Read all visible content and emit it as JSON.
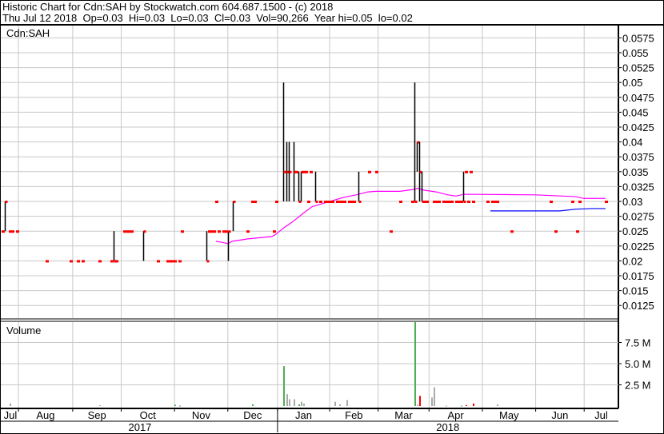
{
  "header": {
    "title": "Historic Chart for Cdn:SAH by Stockwatch.com 604.687.1500 - (c) 2018",
    "quote": "Thu Jul 12 2018  Op=0.03  Hi=0.03  Lo=0.03  Cl=0.03  Vol=90,266  Year hi=0.05  lo=0.02"
  },
  "colors": {
    "bar": "#000000",
    "close_tick": "#ff0000",
    "ma_long": "#ff00ff",
    "ma_short": "#0000ff",
    "vol_up": "#4caf50",
    "vol_down": "#ff0000",
    "vol_flat": "#aaaaaa",
    "grid": "#c8c8c8"
  },
  "chart_data": [
    {
      "type": "ohlc",
      "title": "Cdn:SAH",
      "x_unit": "trading day index (Jul 2017 - Jul 12 2018)",
      "xlim": [
        0,
        250
      ],
      "ylim": [
        0.01,
        0.06
      ],
      "y_ticks": [
        "0.0575",
        "0.055",
        "0.0525",
        "0.05",
        "0.0475",
        "0.045",
        "0.0425",
        "0.04",
        "0.0375",
        "0.035",
        "0.0325",
        "0.03",
        "0.0275",
        "0.025",
        "0.0225",
        "0.02",
        "0.0175",
        "0.015",
        "0.0125"
      ],
      "grid": true,
      "bars": [
        [
          1,
          0.03,
          0.025,
          0.03
        ],
        [
          46,
          0.025,
          0.02,
          0.02
        ],
        [
          58,
          0.025,
          0.02,
          0.025
        ],
        [
          84,
          0.025,
          0.02,
          0.02
        ],
        [
          93,
          0.025,
          0.02,
          0.025
        ],
        [
          95,
          0.03,
          0.025,
          0.03
        ],
        [
          116,
          0.05,
          0.03,
          0.035
        ],
        [
          117,
          0.04,
          0.03,
          0.035
        ],
        [
          118,
          0.04,
          0.03,
          0.035
        ],
        [
          120,
          0.04,
          0.03,
          0.035
        ],
        [
          122,
          0.035,
          0.03,
          0.03
        ],
        [
          123,
          0.035,
          0.03,
          0.035
        ],
        [
          129,
          0.035,
          0.03,
          0.03
        ],
        [
          147,
          0.035,
          0.03,
          0.03
        ],
        [
          170,
          0.05,
          0.03,
          0.03
        ],
        [
          171,
          0.04,
          0.035,
          0.04
        ],
        [
          172,
          0.04,
          0.03,
          0.035
        ],
        [
          173,
          0.035,
          0.03,
          0.03
        ],
        [
          190,
          0.035,
          0.03,
          0.03
        ]
      ],
      "closes": [
        [
          0,
          0.025
        ],
        [
          3,
          0.025
        ],
        [
          4,
          0.025
        ],
        [
          6,
          0.025
        ],
        [
          18,
          0.02
        ],
        [
          28,
          0.02
        ],
        [
          31,
          0.02
        ],
        [
          33,
          0.02
        ],
        [
          40,
          0.02
        ],
        [
          45,
          0.02
        ],
        [
          47,
          0.02
        ],
        [
          50,
          0.025
        ],
        [
          51,
          0.025
        ],
        [
          52,
          0.025
        ],
        [
          53,
          0.025
        ],
        [
          64,
          0.02
        ],
        [
          68,
          0.02
        ],
        [
          69,
          0.02
        ],
        [
          70,
          0.02
        ],
        [
          71,
          0.02
        ],
        [
          73,
          0.02
        ],
        [
          74,
          0.025
        ],
        [
          85,
          0.025
        ],
        [
          86,
          0.025
        ],
        [
          87,
          0.025
        ],
        [
          88,
          0.03
        ],
        [
          89,
          0.025
        ],
        [
          91,
          0.025
        ],
        [
          92,
          0.025
        ],
        [
          101,
          0.025
        ],
        [
          103,
          0.03
        ],
        [
          104,
          0.03
        ],
        [
          112,
          0.025
        ],
        [
          113,
          0.03
        ],
        [
          121,
          0.035
        ],
        [
          124,
          0.035
        ],
        [
          125,
          0.035
        ],
        [
          126,
          0.03
        ],
        [
          127,
          0.035
        ],
        [
          131,
          0.03
        ],
        [
          133,
          0.03
        ],
        [
          134,
          0.03
        ],
        [
          135,
          0.03
        ],
        [
          136,
          0.03
        ],
        [
          138,
          0.03
        ],
        [
          139,
          0.03
        ],
        [
          140,
          0.03
        ],
        [
          141,
          0.03
        ],
        [
          143,
          0.03
        ],
        [
          144,
          0.03
        ],
        [
          145,
          0.03
        ],
        [
          151,
          0.035
        ],
        [
          154,
          0.035
        ],
        [
          160,
          0.025
        ],
        [
          164,
          0.03
        ],
        [
          169,
          0.03
        ],
        [
          174,
          0.03
        ],
        [
          175,
          0.03
        ],
        [
          178,
          0.03
        ],
        [
          179,
          0.03
        ],
        [
          180,
          0.03
        ],
        [
          182,
          0.03
        ],
        [
          183,
          0.03
        ],
        [
          184,
          0.03
        ],
        [
          185,
          0.03
        ],
        [
          187,
          0.03
        ],
        [
          188,
          0.03
        ],
        [
          189,
          0.03
        ],
        [
          191,
          0.035
        ],
        [
          192,
          0.03
        ],
        [
          193,
          0.035
        ],
        [
          194,
          0.03
        ],
        [
          200,
          0.03
        ],
        [
          202,
          0.03
        ],
        [
          203,
          0.03
        ],
        [
          204,
          0.03
        ],
        [
          210,
          0.025
        ],
        [
          226,
          0.03
        ],
        [
          228,
          0.025
        ],
        [
          235,
          0.03
        ],
        [
          237,
          0.025
        ],
        [
          238,
          0.03
        ],
        [
          249,
          0.03
        ]
      ],
      "series": [
        {
          "name": "long moving average",
          "color": "#ff00ff",
          "points": [
            [
              88.1,
              0.0233
            ],
            [
              90.8,
              0.0231
            ],
            [
              93.1,
              0.0229
            ],
            [
              94.7,
              0.0233
            ],
            [
              101.3,
              0.0237
            ],
            [
              111.2,
              0.0241
            ],
            [
              112.9,
              0.0245
            ],
            [
              116.2,
              0.0256
            ],
            [
              119.5,
              0.0265
            ],
            [
              124.4,
              0.0281
            ],
            [
              127.7,
              0.0291
            ],
            [
              131,
              0.0295
            ],
            [
              136,
              0.0301
            ],
            [
              140.9,
              0.0307
            ],
            [
              145.9,
              0.0311
            ],
            [
              150.8,
              0.0316
            ],
            [
              154.1,
              0.0317
            ],
            [
              164,
              0.0317
            ],
            [
              169.3,
              0.032
            ],
            [
              171.3,
              0.0322
            ],
            [
              173.9,
              0.0319
            ],
            [
              178.9,
              0.0316
            ],
            [
              183.8,
              0.0311
            ],
            [
              187.1,
              0.0309
            ],
            [
              190.4,
              0.0312
            ],
            [
              220.1,
              0.0311
            ],
            [
              236.6,
              0.0308
            ],
            [
              239.9,
              0.0305
            ],
            [
              248.8,
              0.0305
            ]
          ]
        },
        {
          "name": "short moving average",
          "color": "#0000ff",
          "points": [
            [
              201.3,
              0.0284
            ],
            [
              230,
              0.0284
            ],
            [
              236.6,
              0.0287
            ],
            [
              243.2,
              0.0288
            ],
            [
              248.8,
              0.0288
            ]
          ]
        }
      ]
    },
    {
      "type": "bar",
      "title": "Volume",
      "ylim": [
        0,
        10
      ],
      "y_unit": "M",
      "y_ticks": [
        {
          "v": 2.5,
          "label": "2.5 M"
        },
        {
          "v": 5,
          "label": "5.0 M"
        },
        {
          "v": 7.5,
          "label": "7.5 M"
        }
      ],
      "bars": [
        [
          3,
          0.3,
          "flat"
        ],
        [
          40,
          0.1,
          "flat"
        ],
        [
          71,
          0.15,
          "up"
        ],
        [
          73,
          0.05,
          "up"
        ],
        [
          103,
          0.2,
          "up"
        ],
        [
          116,
          4.7,
          "up"
        ],
        [
          117,
          1.4,
          "flat"
        ],
        [
          118,
          0.8,
          "flat"
        ],
        [
          120,
          0.8,
          "flat"
        ],
        [
          122,
          0.2,
          "up"
        ],
        [
          123,
          0.5,
          "flat"
        ],
        [
          124,
          0.3,
          "flat"
        ],
        [
          137,
          0.5,
          "flat"
        ],
        [
          139,
          0.2,
          "flat"
        ],
        [
          142,
          0.7,
          "flat"
        ],
        [
          170,
          9.9,
          "up"
        ],
        [
          171,
          0.15,
          "flat"
        ],
        [
          172,
          1.2,
          "down"
        ],
        [
          177,
          1.0,
          "flat"
        ],
        [
          178,
          2.2,
          "flat"
        ],
        [
          183,
          0.05,
          "flat"
        ],
        [
          189,
          0.05,
          "up"
        ],
        [
          191,
          0.1,
          "down"
        ],
        [
          194,
          0.3,
          "down"
        ],
        [
          204,
          0.2,
          "flat"
        ]
      ]
    }
  ],
  "x_axis": {
    "months": [
      {
        "label": "Jul",
        "start": -1,
        "end": 6.6
      },
      {
        "label": "Aug",
        "start": 6.6,
        "end": 29
      },
      {
        "label": "Sep",
        "start": 29,
        "end": 49
      },
      {
        "label": "Oct",
        "start": 49,
        "end": 71
      },
      {
        "label": "Nov",
        "start": 71,
        "end": 93
      },
      {
        "label": "Dec",
        "start": 93,
        "end": 113.5
      },
      {
        "label": "Jan",
        "start": 113.5,
        "end": 135
      },
      {
        "label": "Feb",
        "start": 135,
        "end": 155
      },
      {
        "label": "Mar",
        "start": 155,
        "end": 176
      },
      {
        "label": "Apr",
        "start": 176,
        "end": 198
      },
      {
        "label": "May",
        "start": 198,
        "end": 220
      },
      {
        "label": "Jun",
        "start": 220,
        "end": 240
      },
      {
        "label": "Jul",
        "start": 240,
        "end": 254
      }
    ],
    "years": [
      {
        "label": "2017",
        "start": -1,
        "end": 113.5
      },
      {
        "label": "2018",
        "start": 113.5,
        "end": 254
      }
    ]
  }
}
